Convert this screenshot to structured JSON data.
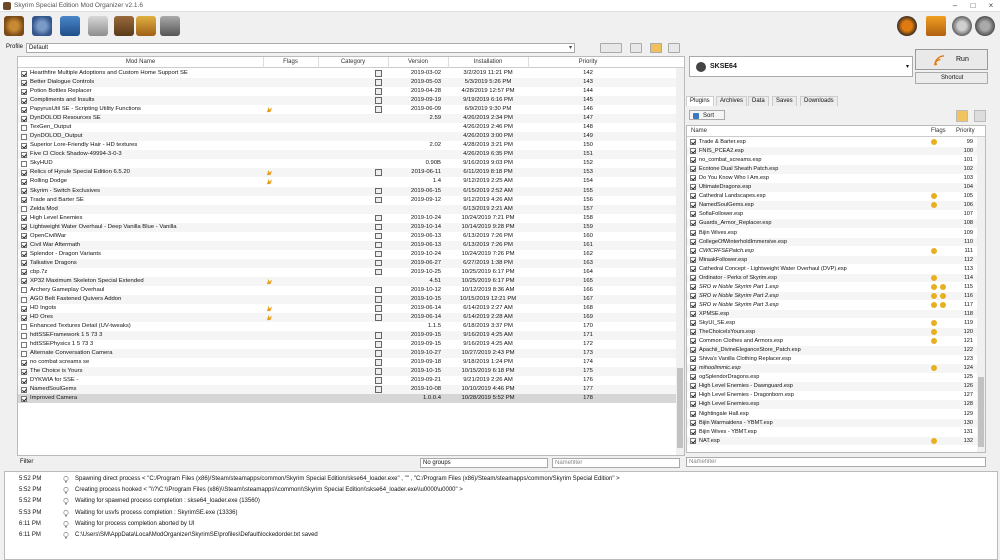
{
  "window": {
    "title": "Skyrim Special Edition Mod Organizer v2.1.6"
  },
  "profile": {
    "label": "Profile",
    "value": "Default"
  },
  "mod_table": {
    "headers": [
      "Mod Name",
      "Flags",
      "Category",
      "Version",
      "Installation",
      "Priority"
    ],
    "rows": [
      {
        "name": "Hearthfire Multiple Adoptions and Custom Home Support SE",
        "checked": true,
        "flag": false,
        "cat": true,
        "version": "2019-03-02",
        "installed": "3/2/2019 11:21 PM",
        "priority": "142"
      },
      {
        "name": "Better Dialogue Controls",
        "checked": true,
        "flag": false,
        "cat": true,
        "version": "2019-05-03",
        "installed": "5/3/2019 5:26 PM",
        "priority": "143"
      },
      {
        "name": "Potion Bottles Replacer",
        "checked": true,
        "flag": false,
        "cat": true,
        "version": "2019-04-28",
        "installed": "4/28/2019 12:57 PM",
        "priority": "144"
      },
      {
        "name": "Compliments and Insults",
        "checked": true,
        "flag": false,
        "cat": true,
        "version": "2019-09-19",
        "installed": "9/19/2019 6:16 PM",
        "priority": "145"
      },
      {
        "name": "PapyrusUtil SE - Scripting Utility Functions",
        "checked": true,
        "flag": true,
        "cat": true,
        "version": "2019-06-09",
        "installed": "6/9/2019 9:30 PM",
        "priority": "146"
      },
      {
        "name": "DynDOLOD Resources SE",
        "checked": true,
        "flag": false,
        "cat": false,
        "version": "2.59",
        "installed": "4/26/2019 2:34 PM",
        "priority": "147"
      },
      {
        "name": "TexGen_Output",
        "checked": false,
        "flag": false,
        "cat": false,
        "version": "",
        "installed": "4/26/2019 2:46 PM",
        "priority": "148"
      },
      {
        "name": "DynDOLOD_Output",
        "checked": false,
        "flag": false,
        "cat": false,
        "version": "",
        "installed": "4/26/2019 3:00 PM",
        "priority": "149"
      },
      {
        "name": "Superior Lore-Friendly Hair - HD textures",
        "checked": true,
        "flag": false,
        "cat": false,
        "version": "2.02",
        "installed": "4/28/2019 3:21 PM",
        "priority": "150"
      },
      {
        "name": "Five Cl Clock Shadow-49994-3-0-3",
        "checked": true,
        "flag": false,
        "cat": false,
        "version": "",
        "installed": "4/26/2019 6:35 PM",
        "priority": "151"
      },
      {
        "name": "SkyHUD",
        "checked": false,
        "flag": false,
        "cat": false,
        "version": "0.90B",
        "installed": "9/16/2019 9:03 PM",
        "priority": "152"
      },
      {
        "name": "Relics of Hyrule Special Edition 6.5.20",
        "checked": true,
        "flag": true,
        "cat": true,
        "version": "2019-06-11",
        "installed": "6/11/2019 8:18 PM",
        "priority": "153"
      },
      {
        "name": "Rolling Dodge",
        "checked": true,
        "flag": true,
        "cat": false,
        "version": "1.4",
        "installed": "9/12/2019 2:25 AM",
        "priority": "154"
      },
      {
        "name": "Skyrim - Switch Exclusives",
        "checked": true,
        "flag": false,
        "cat": true,
        "version": "2019-06-15",
        "installed": "6/15/2019 2:52 AM",
        "priority": "155"
      },
      {
        "name": "Trade and Barter SE",
        "checked": true,
        "flag": false,
        "cat": true,
        "version": "2019-09-12",
        "installed": "9/12/2019 4:26 AM",
        "priority": "156"
      },
      {
        "name": "Zelda Mod",
        "checked": false,
        "flag": false,
        "cat": false,
        "version": "",
        "installed": "6/13/2019 2:21 AM",
        "priority": "157"
      },
      {
        "name": "High Level Enemies",
        "checked": true,
        "flag": false,
        "cat": true,
        "version": "2019-10-24",
        "installed": "10/24/2019 7:21 PM",
        "priority": "158"
      },
      {
        "name": "Lightweight Water Overhaul - Deep Vanilla Blue - Vanilla",
        "checked": true,
        "flag": false,
        "cat": true,
        "version": "2019-10-14",
        "installed": "10/14/2019 9:28 PM",
        "priority": "159"
      },
      {
        "name": "OpenCivilWar",
        "checked": true,
        "flag": false,
        "cat": true,
        "version": "2019-06-13",
        "installed": "6/13/2019 7:26 PM",
        "priority": "160"
      },
      {
        "name": "Civil War Aftermath",
        "checked": true,
        "flag": false,
        "cat": true,
        "version": "2019-06-13",
        "installed": "6/13/2019 7:26 PM",
        "priority": "161"
      },
      {
        "name": "Splendor - Dragon Variants",
        "checked": true,
        "flag": false,
        "cat": true,
        "version": "2019-10-24",
        "installed": "10/24/2019 7:26 PM",
        "priority": "162"
      },
      {
        "name": "Talkative Dragons",
        "checked": true,
        "flag": false,
        "cat": true,
        "version": "2019-06-27",
        "installed": "6/27/2019 1:38 PM",
        "priority": "163"
      },
      {
        "name": "cbp.7z",
        "checked": true,
        "flag": false,
        "cat": true,
        "version": "2019-10-25",
        "installed": "10/25/2019 6:17 PM",
        "priority": "164"
      },
      {
        "name": "XP32 Maximum Skeleton Special Extended",
        "checked": true,
        "flag": true,
        "cat": false,
        "version": "4.51",
        "installed": "10/25/2019 6:17 PM",
        "priority": "165"
      },
      {
        "name": "Archery Gameplay Overhaul",
        "checked": false,
        "flag": false,
        "cat": true,
        "version": "2019-10-12",
        "installed": "10/12/2019 8:36 AM",
        "priority": "166"
      },
      {
        "name": "AGO Belt Fastened Quivers Addon",
        "checked": false,
        "flag": false,
        "cat": true,
        "version": "2019-10-15",
        "installed": "10/15/2019 12:21 PM",
        "priority": "167"
      },
      {
        "name": "HD Ingots",
        "checked": true,
        "flag": true,
        "cat": true,
        "version": "2019-06-14",
        "installed": "6/14/2019 2:27 AM",
        "priority": "168"
      },
      {
        "name": "HD Ores",
        "checked": true,
        "flag": true,
        "cat": true,
        "version": "2019-06-14",
        "installed": "6/14/2019 2:28 AM",
        "priority": "169"
      },
      {
        "name": "Enhanced Textures Detail (UV-tweaks)",
        "checked": false,
        "flag": false,
        "cat": false,
        "version": "1.1.5",
        "installed": "6/18/2019 3:37 PM",
        "priority": "170"
      },
      {
        "name": "hdtSSEFramework 1 5 73 3",
        "checked": false,
        "flag": false,
        "cat": true,
        "version": "2019-09-15",
        "installed": "9/16/2019 4:25 AM",
        "priority": "171"
      },
      {
        "name": "hdtSSEPhysics 1 5 73 3",
        "checked": false,
        "flag": false,
        "cat": true,
        "version": "2019-09-15",
        "installed": "9/16/2019 4:25 AM",
        "priority": "172"
      },
      {
        "name": "Alternate Conversation Camera",
        "checked": false,
        "flag": false,
        "cat": true,
        "version": "2019-10-27",
        "installed": "10/27/2019 2:43 PM",
        "priority": "173"
      },
      {
        "name": "no combat screams se",
        "checked": true,
        "flag": false,
        "cat": true,
        "version": "2019-09-18",
        "installed": "9/18/2019 1:24 PM",
        "priority": "174"
      },
      {
        "name": "The Choice is Yours",
        "checked": true,
        "flag": false,
        "cat": true,
        "version": "2019-10-15",
        "installed": "10/15/2019 6:18 PM",
        "priority": "175"
      },
      {
        "name": "DYKWIA for SSE -",
        "checked": true,
        "flag": false,
        "cat": true,
        "version": "2019-09-21",
        "installed": "9/21/2019 2:26 AM",
        "priority": "176"
      },
      {
        "name": "NamedSoulGems",
        "checked": true,
        "flag": false,
        "cat": true,
        "version": "2019-10-08",
        "installed": "10/10/2019 4:46 PM",
        "priority": "177"
      },
      {
        "name": "Improved Camera",
        "checked": true,
        "flag": false,
        "cat": false,
        "version": "1.0.0.4",
        "installed": "10/28/2019 5:52 PM",
        "priority": "178",
        "selected": true
      }
    ]
  },
  "filter": {
    "label": "Filter",
    "groups": "No groups",
    "namefilter_placeholder": "Namefilter"
  },
  "executable": {
    "name": "SKSE64",
    "run_label": "Run",
    "shortcut_label": "Shortcut"
  },
  "tabs": [
    "Plugins",
    "Archives",
    "Data",
    "Saves",
    "Downloads"
  ],
  "sort_label": "Sort",
  "plugin_table": {
    "headers": [
      "Name",
      "Flags",
      "Priority"
    ],
    "rows": [
      {
        "name": "Trade & Barter.esp",
        "checked": true,
        "flags": 1,
        "priority": "99"
      },
      {
        "name": "FNIS_PCEA2.esp",
        "checked": true,
        "flags": 0,
        "priority": "100"
      },
      {
        "name": "no_combat_screams.esp",
        "checked": true,
        "flags": 0,
        "priority": "101"
      },
      {
        "name": "Ecotone Dual Sheath Patch.esp",
        "checked": true,
        "flags": 0,
        "priority": "102"
      },
      {
        "name": "Do You Know Who I Am.esp",
        "checked": true,
        "flags": 0,
        "priority": "103"
      },
      {
        "name": "UltimateDragons.esp",
        "checked": true,
        "flags": 0,
        "priority": "104"
      },
      {
        "name": "Cathedral Landscapes.esp",
        "checked": true,
        "flags": 1,
        "priority": "105"
      },
      {
        "name": "NamedSoulGems.esp",
        "checked": true,
        "flags": 1,
        "priority": "106"
      },
      {
        "name": "SofiaFollower.esp",
        "checked": true,
        "flags": 0,
        "priority": "107"
      },
      {
        "name": "Guards_Armor_Replacer.esp",
        "checked": true,
        "flags": 0,
        "priority": "108"
      },
      {
        "name": "Bijin Wives.esp",
        "checked": true,
        "flags": 0,
        "priority": "109"
      },
      {
        "name": "CollegeOfWinterholdImmersive.esp",
        "checked": true,
        "flags": 0,
        "priority": "110"
      },
      {
        "name": "CWICRFSEPatch.esp",
        "checked": true,
        "flags": 1,
        "priority": "111",
        "italic": true
      },
      {
        "name": "MiraakFollower.esp",
        "checked": true,
        "flags": 0,
        "priority": "112"
      },
      {
        "name": "Cathedral Concept - Lightweight Water Overhaul (DVP).esp",
        "checked": true,
        "flags": 0,
        "priority": "113"
      },
      {
        "name": "Ordinator - Perks of Skyrim.esp",
        "checked": true,
        "flags": 1,
        "priority": "114"
      },
      {
        "name": "SRO w Noble Skyrim Part 1.esp",
        "checked": true,
        "flags": 2,
        "priority": "115",
        "italic": true
      },
      {
        "name": "SRO w Noble Skyrim Part 2.esp",
        "checked": true,
        "flags": 2,
        "priority": "116",
        "italic": true
      },
      {
        "name": "SRO w Noble Skyrim Part 3.esp",
        "checked": true,
        "flags": 2,
        "priority": "117",
        "italic": true
      },
      {
        "name": "XPMSE.esp",
        "checked": true,
        "flags": 0,
        "priority": "118"
      },
      {
        "name": "SkyUI_SE.esp",
        "checked": true,
        "flags": 1,
        "priority": "119"
      },
      {
        "name": "TheChoiceIsYours.esp",
        "checked": true,
        "flags": 1,
        "priority": "120"
      },
      {
        "name": "Common Clothes and Armors.esp",
        "checked": true,
        "flags": 1,
        "priority": "121"
      },
      {
        "name": "Apachii_DivineEleganceStore_Patch.esp",
        "checked": true,
        "flags": 0,
        "priority": "122"
      },
      {
        "name": "Shiva's Vanilla Clothing Replacer.esp",
        "checked": true,
        "flags": 0,
        "priority": "123"
      },
      {
        "name": "mihoolimmic.esp",
        "checked": true,
        "flags": 1,
        "priority": "124",
        "italic": true
      },
      {
        "name": "ogSplendorDragons.esp",
        "checked": true,
        "flags": 0,
        "priority": "125"
      },
      {
        "name": "High Level Enemies - Dawnguard.esp",
        "checked": true,
        "flags": 0,
        "priority": "126"
      },
      {
        "name": "High Level Enemies - Dragonborn.esp",
        "checked": true,
        "flags": 0,
        "priority": "127"
      },
      {
        "name": "High Level Enemies.esp",
        "checked": true,
        "flags": 0,
        "priority": "128"
      },
      {
        "name": "Nightingale Hall.esp",
        "checked": true,
        "flags": 0,
        "priority": "129"
      },
      {
        "name": "Bijin Warmaidens - YBMT.esp",
        "checked": true,
        "flags": 0,
        "priority": "130"
      },
      {
        "name": "Bijin Wives - YBMT.esp",
        "checked": true,
        "flags": 0,
        "priority": "131"
      },
      {
        "name": "NAT.esp",
        "checked": true,
        "flags": 1,
        "priority": "132"
      }
    ]
  },
  "log": [
    {
      "time": "5:52 PM",
      "msg": "Spawning direct process < \"C:/Program Files (x86)/Steam/steamapps/common/Skyrim Special Edition/skse64_loader.exe\" , \"\" , \"C:/Program Files (x86)/Steam/steamapps/common/Skyrim Special Edition\" >"
    },
    {
      "time": "5:52 PM",
      "msg": "Creating process hooked < \"\\\\?\\C:\\\\Program Files (x86)\\\\Steam\\\\steamapps\\\\common\\\\Skyrim Special Edition\\\\skse64_loader.exe\\\\u0000\\u0000\" >"
    },
    {
      "time": "5:52 PM",
      "msg": "Waiting for spawned process completion : skse64_loader.exe (13560)"
    },
    {
      "time": "5:53 PM",
      "msg": "Waiting for usvfs process completion : SkyrimSE.exe (13336)"
    },
    {
      "time": "6:11 PM",
      "msg": "Waiting for process completion aborted by UI"
    },
    {
      "time": "6:11 PM",
      "msg": "C:\\Users\\SM\\AppData\\Local\\ModOrganizer\\SkyrimSE\\profiles\\Default\\lockedorder.txt saved"
    }
  ],
  "colors": {
    "accent": "#e8b020",
    "selection": "#d6d6d6",
    "warning": "#f0a020"
  }
}
